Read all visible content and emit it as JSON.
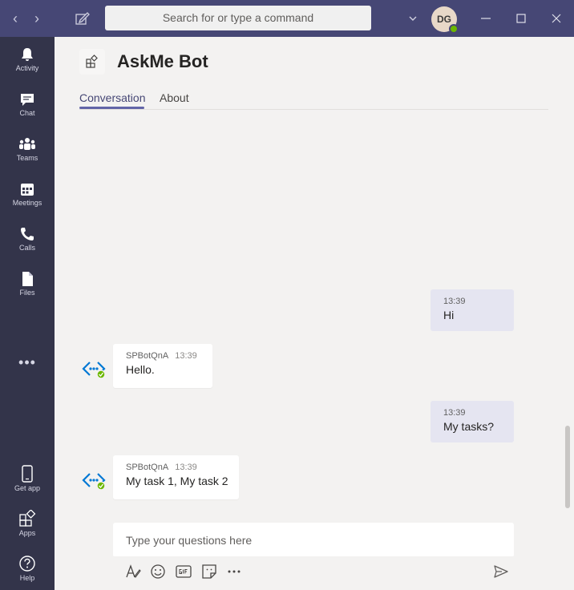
{
  "titlebar": {
    "search_placeholder": "Search for or type a command",
    "avatar_initials": "DG"
  },
  "rail": {
    "items": [
      {
        "label": "Activity",
        "icon": "bell-icon"
      },
      {
        "label": "Chat",
        "icon": "chat-icon"
      },
      {
        "label": "Teams",
        "icon": "teams-icon"
      },
      {
        "label": "Meetings",
        "icon": "calendar-icon"
      },
      {
        "label": "Calls",
        "icon": "phone-icon"
      },
      {
        "label": "Files",
        "icon": "file-icon"
      }
    ],
    "more": "•••",
    "bottom": [
      {
        "label": "Get app",
        "icon": "mobile-icon"
      },
      {
        "label": "Apps",
        "icon": "apps-icon"
      },
      {
        "label": "Help",
        "icon": "help-icon"
      }
    ]
  },
  "header": {
    "title": "AskMe Bot",
    "tabs": [
      {
        "label": "Conversation",
        "active": true
      },
      {
        "label": "About",
        "active": false
      }
    ]
  },
  "messages": [
    {
      "from": "me",
      "time": "13:39",
      "text": "Hi"
    },
    {
      "from": "bot",
      "sender": "SPBotQnA",
      "time": "13:39",
      "text": "Hello."
    },
    {
      "from": "me",
      "time": "13:39",
      "text": "My tasks?"
    },
    {
      "from": "bot",
      "sender": "SPBotQnA",
      "time": "13:39",
      "text": "My task 1, My task 2"
    }
  ],
  "composer": {
    "placeholder": "Type your questions here"
  },
  "colors": {
    "titlebar": "#464775",
    "rail": "#33344a",
    "accent": "#6264a7",
    "my_bubble": "#e5e5f1",
    "presence": "#6bb700"
  }
}
